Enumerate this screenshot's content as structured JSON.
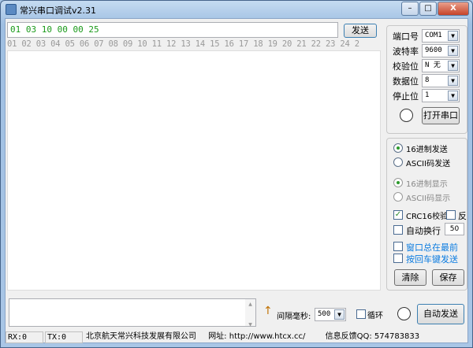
{
  "window": {
    "title": "常兴串口调试v2.31",
    "minimize": "–",
    "maximize": "□",
    "close": "X"
  },
  "send_input": {
    "value": "01 03 10 00 00 25"
  },
  "send_button": "发送",
  "ruler": "01 02 03 04 05 06 07 08 09 10 11 12 13 14 15 16 17 18 19 20 21 22 23 24 2",
  "serial": {
    "port_label": "端口号",
    "port": "COM1",
    "baud_label": "波特率",
    "baud": "9600",
    "parity_label": "校验位",
    "parity": "N 无",
    "databits_label": "数据位",
    "databits": "8",
    "stopbits_label": "停止位",
    "stopbits": "1",
    "open_button": "打开串口"
  },
  "options": {
    "hex_send": "16进制发送",
    "ascii_send": "ASCII码发送",
    "hex_display": "16进制显示",
    "ascii_display": "ASCII码显示",
    "crc16": "CRC16校验",
    "reverse": "反",
    "auto_wrap": "自动换行",
    "wrap_width": "50",
    "always_on_top": "窗口总在最前",
    "enter_send": "按回车键发送",
    "clear_button": "清除",
    "save_button": "保存"
  },
  "bottom": {
    "interval_label": "间隔毫秒:",
    "interval": "500",
    "loop_label": "循环",
    "auto_send_button": "自动发送"
  },
  "statusbar": {
    "rx": "RX:0",
    "tx": "TX:0",
    "company": "北京航天常兴科技发展有限公司",
    "website": "网址: http://www.htcx.cc/",
    "feedback": "信息反馈QQ: 574783833"
  }
}
